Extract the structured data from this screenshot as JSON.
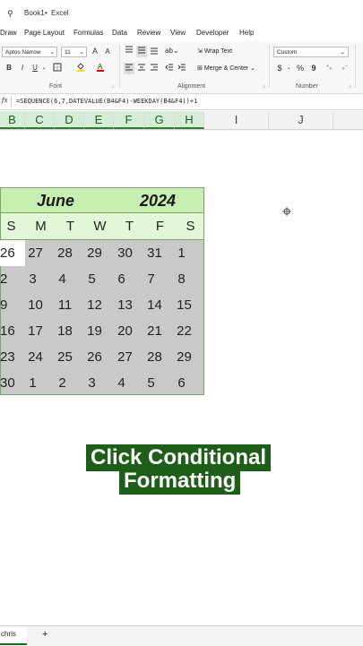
{
  "window": {
    "qat_icon": "pin-icon",
    "workbook": "Book1",
    "sep": "•",
    "app": "Excel"
  },
  "menu": {
    "tabs": [
      "Draw",
      "Page Layout",
      "Formulas",
      "Data",
      "Review",
      "View",
      "Developer",
      "Help"
    ]
  },
  "ribbon": {
    "font_name": "Aptos Narrow",
    "font_size": "11",
    "grow_font": "A",
    "shrink_font": "A",
    "bold": "B",
    "italic": "I",
    "underline": "U",
    "wrap_text": "Wrap Text",
    "merge_center": "Merge & Center",
    "number_format": "Custom",
    "currency": "$",
    "percent": "%",
    "comma": "9",
    "group_font": "Font",
    "group_alignment": "Alignment",
    "group_number": "Number"
  },
  "formula_bar": {
    "fx": "fx",
    "formula": "=SEQUENCE(6,7,DATEVALUE(B4&F4)-WEEKDAY(B4&F4))+1"
  },
  "columns": [
    "B",
    "C",
    "D",
    "E",
    "F",
    "G",
    "H",
    "I",
    "J"
  ],
  "calendar": {
    "month": "June",
    "year": "2024",
    "weekdays": [
      "S",
      "M",
      "T",
      "W",
      "T",
      "F",
      "S"
    ],
    "weeks": [
      [
        "26",
        "27",
        "28",
        "29",
        "30",
        "31",
        "1"
      ],
      [
        "2",
        "3",
        "4",
        "5",
        "6",
        "7",
        "8"
      ],
      [
        "9",
        "10",
        "11",
        "12",
        "13",
        "14",
        "15"
      ],
      [
        "16",
        "17",
        "18",
        "19",
        "20",
        "21",
        "22"
      ],
      [
        "23",
        "24",
        "25",
        "26",
        "27",
        "28",
        "29"
      ],
      [
        "30",
        "1",
        "2",
        "3",
        "4",
        "5",
        "6"
      ]
    ]
  },
  "caption": {
    "line1": "Click Conditional",
    "line2": "Formatting"
  },
  "sheet_tabs": {
    "active": "chris",
    "add": "+"
  },
  "colors": {
    "title_fill": "#c6efb1",
    "weekday_fill": "#e2f7d6",
    "date_fill": "#c9c9c9",
    "caption_bg": "#1d5e18",
    "header_selected": "#d7ecd7"
  }
}
